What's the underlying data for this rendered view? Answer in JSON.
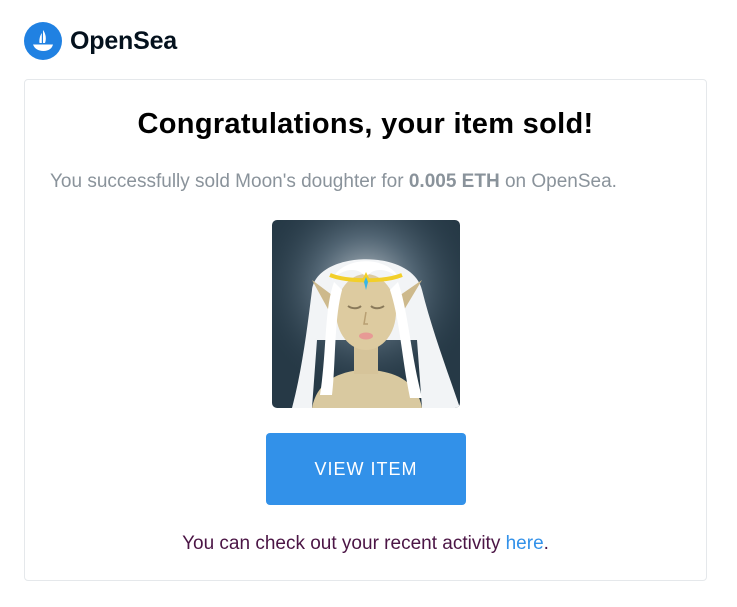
{
  "brand": {
    "name": "OpenSea",
    "logo_color": "#2081E2",
    "logo_icon": "opensea-boat-icon"
  },
  "card": {
    "title": "Congratulations, your item sold!",
    "message": {
      "prefix": "You successfully sold Moon's doughter for ",
      "price": "0.005 ETH",
      "suffix": " on OpenSea."
    },
    "image": {
      "alt": "Moon's doughter",
      "icon": "nft-elf-portrait"
    },
    "button_label": "VIEW ITEM",
    "activity": {
      "prefix": "You can check out your recent activity ",
      "link_label": "here",
      "suffix": "."
    }
  },
  "colors": {
    "button": "#3291E9",
    "link": "#3291E9",
    "activity_text": "#4B1545",
    "muted_text": "#8A939B"
  }
}
